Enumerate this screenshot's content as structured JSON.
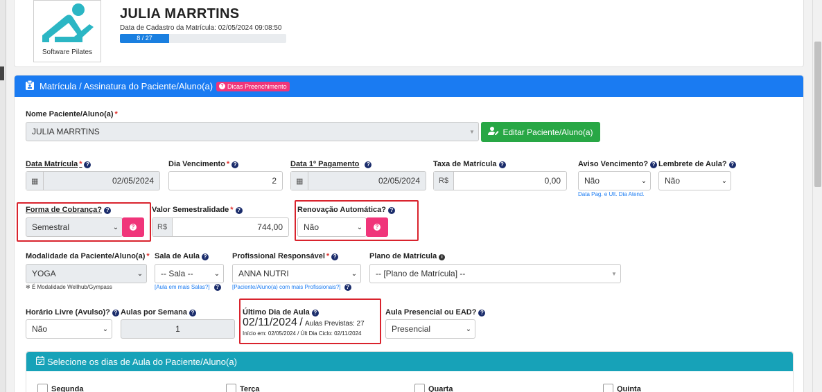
{
  "header": {
    "logo_text": "Software Pilates",
    "patient_name": "JULIA MARRTINS",
    "registration_date": "Data de Cadastro da Matrícula: 02/05/2024 09:08:50",
    "progress_label": "8 / 27",
    "progress_fraction": 0.296
  },
  "card": {
    "title": "Matrícula / Assinatura do Paciente/Aluno(a)",
    "tips_badge": "Dicas Preenchimento"
  },
  "form": {
    "patient": {
      "label": "Nome Paciente/Aluno(a)",
      "value": "JULIA MARRTINS",
      "edit_button": "Editar Paciente/Aluno(a)"
    },
    "enroll_date": {
      "label": "Data Matrícula",
      "value": "02/05/2024"
    },
    "due_day": {
      "label": "Dia Vencimento",
      "value": "2"
    },
    "first_payment": {
      "label": "Data 1º Pagamento",
      "value": "02/05/2024"
    },
    "enroll_fee": {
      "label": "Taxa de Matrícula",
      "currency": "R$",
      "value": "0,00"
    },
    "due_notice": {
      "label": "Aviso Vencimento?",
      "value": "Não",
      "hint": "Data Pag. e Ult. Dia Atend."
    },
    "class_reminder": {
      "label": "Lembrete de Aula?",
      "value": "Não"
    },
    "billing": {
      "label": "Forma de Cobrança?",
      "value": "Semestral"
    },
    "semester_value": {
      "label": "Valor Semestralidade",
      "currency": "R$",
      "value": "744,00"
    },
    "auto_renew": {
      "label": "Renovação Automática?",
      "value": "Não"
    },
    "modality": {
      "label": "Modalidade da Paciente/Aluno(a)",
      "value": "YOGA",
      "hint": "É Modalidade Wellhub/Gympass"
    },
    "room": {
      "label": "Sala de Aula",
      "value": "-- Sala --",
      "hint": "[Aula em mais Salas?]"
    },
    "professional": {
      "label": "Profissional Responsável",
      "value": "ANNA NUTRI",
      "hint": "[Paciente/Aluno(a) com mais Profissionais?]"
    },
    "plan": {
      "label": "Plano de Matrícula",
      "value": "-- [Plano de Matrícula] --"
    },
    "free_schedule": {
      "label": "Horário Livre (Avulso)?",
      "value": "Não"
    },
    "classes_per_week": {
      "label": "Aulas por Semana",
      "value": "1"
    },
    "last_day": {
      "label": "Último Dia de Aula",
      "date": "02/11/2024",
      "separator": "/",
      "planned": "Aulas Previstas: 27",
      "detail": "Início em: 02/05/2024 / Últ Dia Ciclo: 02/11/2024"
    },
    "mode": {
      "label": "Aula Presencial ou EAD?",
      "value": "Presencial"
    }
  },
  "days": {
    "title": "Selecione os dias de Aula do Paciente/Aluno(a)",
    "items": [
      "Segunda",
      "Terça",
      "Quarta",
      "Quinta"
    ]
  },
  "colors": {
    "primary": "#1a7bf2",
    "success": "#28a745",
    "pink": "#f0357a",
    "info": "#17a2b8",
    "highlight": "#d9232d"
  }
}
